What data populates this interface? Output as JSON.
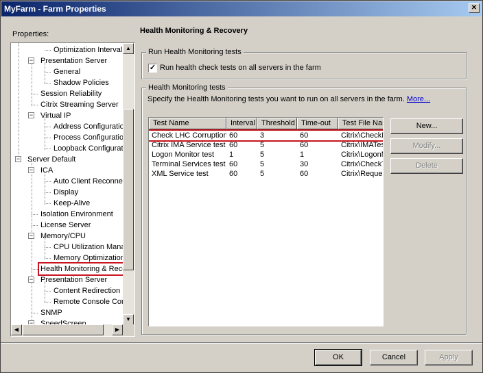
{
  "window": {
    "title": "MyFarm - Farm Properties",
    "close_glyph": "✕"
  },
  "left": {
    "properties_label": "Properties:",
    "tree": [
      {
        "label": "Optimization Interval",
        "name": "tree-item-optimization-interval"
      },
      {
        "label": "Presentation Server",
        "name": "tree-item-presentation-server"
      },
      {
        "label": "General",
        "name": "tree-item-general"
      },
      {
        "label": "Shadow Policies",
        "name": "tree-item-shadow-policies"
      },
      {
        "label": "Session Reliability",
        "name": "tree-item-session-reliability"
      },
      {
        "label": "Citrix Streaming Server",
        "name": "tree-item-citrix-streaming-server"
      },
      {
        "label": "Virtual IP",
        "name": "tree-item-virtual-ip"
      },
      {
        "label": "Address Configuration",
        "name": "tree-item-address-configuration"
      },
      {
        "label": "Process Configuration",
        "name": "tree-item-process-configuration"
      },
      {
        "label": "Loopback Configuration",
        "name": "tree-item-loopback-configuration"
      },
      {
        "label": "Server Default",
        "name": "tree-item-server-default"
      },
      {
        "label": "ICA",
        "name": "tree-item-ica"
      },
      {
        "label": "Auto Client Reconnect",
        "name": "tree-item-auto-client-reconnect"
      },
      {
        "label": "Display",
        "name": "tree-item-display"
      },
      {
        "label": "Keep-Alive",
        "name": "tree-item-keep-alive"
      },
      {
        "label": "Isolation Environment",
        "name": "tree-item-isolation-environment"
      },
      {
        "label": "License Server",
        "name": "tree-item-license-server"
      },
      {
        "label": "Memory/CPU",
        "name": "tree-item-memory-cpu"
      },
      {
        "label": "CPU Utilization Management",
        "name": "tree-item-cpu-utilization-management"
      },
      {
        "label": "Memory Optimization",
        "name": "tree-item-memory-optimization"
      },
      {
        "label": "Health Monitoring & Recovery",
        "name": "tree-item-health-monitoring-recovery"
      },
      {
        "label": "Presentation Server",
        "name": "tree-item-presentation-server-2"
      },
      {
        "label": "Content Redirection",
        "name": "tree-item-content-redirection"
      },
      {
        "label": "Remote Console Connections",
        "name": "tree-item-remote-console-connections"
      },
      {
        "label": "SNMP",
        "name": "tree-item-snmp"
      },
      {
        "label": "SpeedScreen",
        "name": "tree-item-speedscreen"
      }
    ]
  },
  "main": {
    "title": "Health Monitoring & Recovery",
    "run_group": {
      "title": "Run Health Monitoring tests",
      "checkbox_label": "Run health check tests on all servers in the farm",
      "checked_glyph": "✓"
    },
    "tests_group": {
      "title": "Health Monitoring tests",
      "description": "Specify the Health Monitoring tests you want to run on all servers in the farm.",
      "more_link": "More...",
      "columns": [
        "Test Name",
        "Interval",
        "Threshold",
        "Time-out",
        "Test File Name"
      ],
      "rows": [
        [
          "Check LHC Corruption",
          "60",
          "3",
          "60",
          "Citrix\\CheckLHC.dll"
        ],
        [
          "Citrix IMA Service test",
          "60",
          "5",
          "60",
          "Citrix\\IMATest.dll"
        ],
        [
          "Logon Monitor test",
          "1",
          "5",
          "1",
          "Citrix\\LogonMonitor.dll"
        ],
        [
          "Terminal Services test",
          "60",
          "5",
          "30",
          "Citrix\\CheckTermSrv.dll"
        ],
        [
          "XML Service test",
          "60",
          "5",
          "60",
          "Citrix\\RequestTicket.dll"
        ]
      ],
      "buttons": {
        "new": "New...",
        "modify": "Modify...",
        "delete": "Delete"
      }
    }
  },
  "footer": {
    "ok": "OK",
    "cancel": "Cancel",
    "apply": "Apply"
  }
}
